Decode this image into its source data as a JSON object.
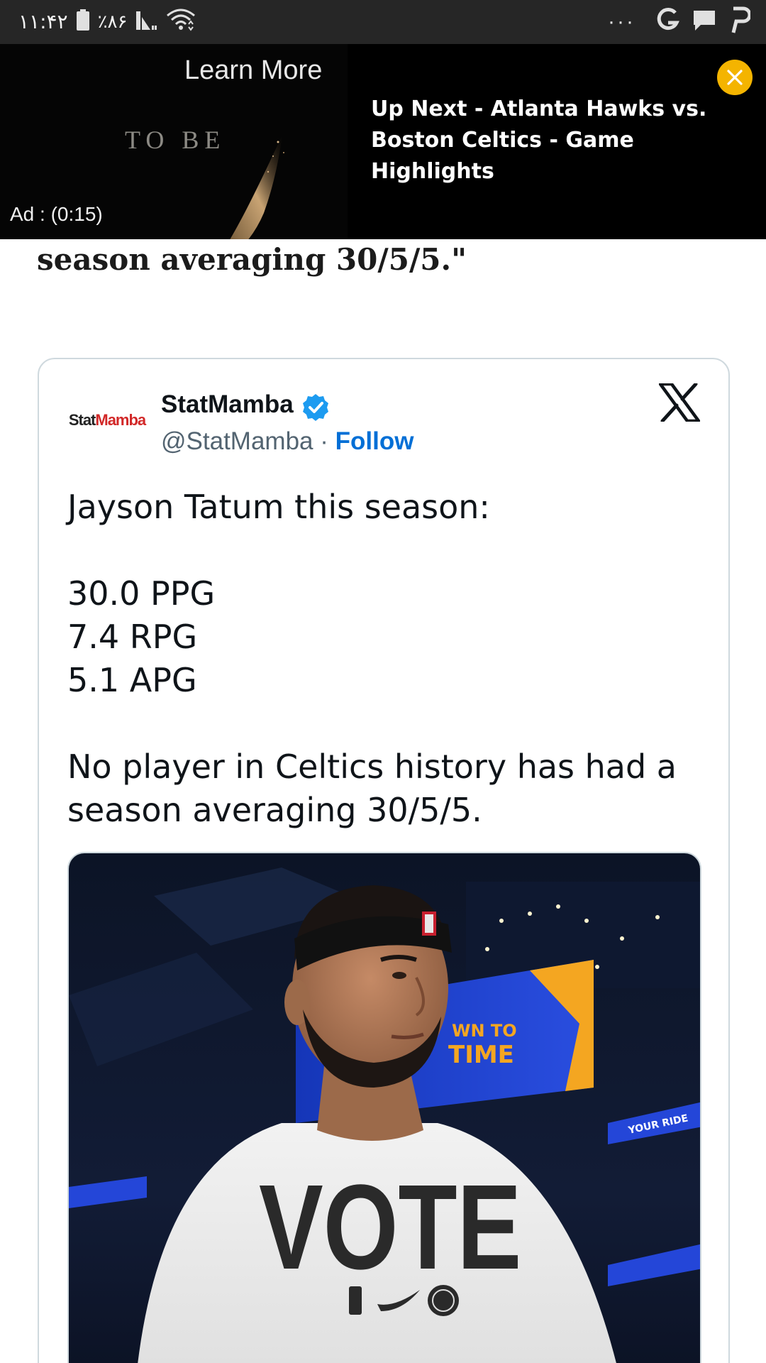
{
  "status_bar": {
    "time": "۱۱:۴۲",
    "battery_percent": "٪۸۶",
    "overflow": "···",
    "icons": [
      "battery-icon",
      "signal-icon",
      "wifi-icon",
      "google-icon",
      "message-icon",
      "p-app-icon"
    ]
  },
  "ad": {
    "learn_more": "Learn More",
    "creative_text": "TO BE",
    "timer": "Ad : (0:15)",
    "up_next_line1": "Up Next - Atlanta Hawks vs.",
    "up_next_line2": "Boston Celtics - Game Highlights",
    "close_color": "#f4b400"
  },
  "article": {
    "quote_tail": "season averaging 30/5/5.\""
  },
  "tweet": {
    "avatar_text_1": "Stat",
    "avatar_text_2": "Mamba",
    "author_name": "StatMamba",
    "handle": "@StatMamba",
    "separator": "·",
    "follow_label": "Follow",
    "lines": [
      "Jayson Tatum this season:",
      "30.0 PPG",
      "7.4 RPG",
      "5.1 APG",
      "No player in Celtics history has had a",
      "season averaging 30/5/5."
    ],
    "media": {
      "jumbotron_text_1": "WN TO",
      "jumbotron_text_2": "TIME",
      "shirt_text": "VOTE",
      "ribbon_text": "YOUR RIDE"
    },
    "accent": "#1d9bf0",
    "follow_color": "#006fd6"
  }
}
